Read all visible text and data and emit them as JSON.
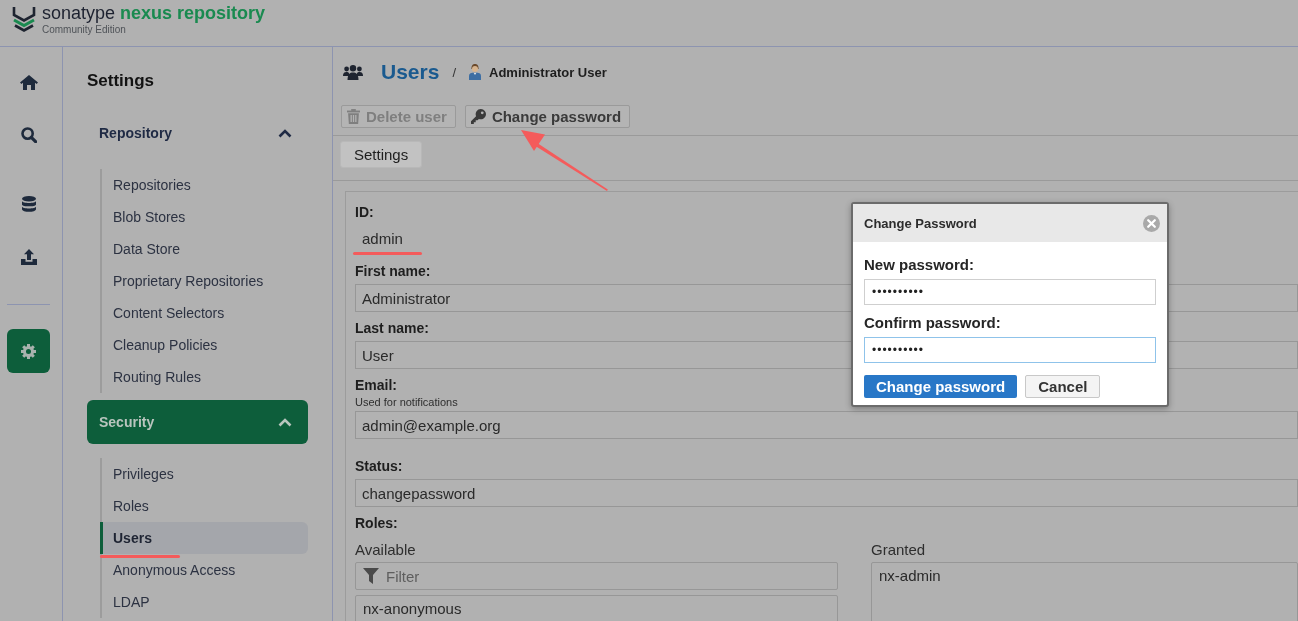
{
  "header": {
    "brand": "sonatype",
    "product": "nexus repository",
    "edition": "Community Edition"
  },
  "rail": {
    "groups": [
      {
        "divider": false,
        "items": [
          {
            "selected": false
          },
          {
            "selected": false
          }
        ]
      },
      {
        "divider": false,
        "items": [
          {
            "selected": false
          },
          {
            "selected": false
          }
        ]
      },
      {
        "divider": true,
        "items": [
          {
            "selected": true
          }
        ]
      }
    ]
  },
  "sidebar": {
    "title": "Settings",
    "groups": [
      {
        "label": "Repository",
        "selected": false,
        "expanded": true,
        "items": [
          {
            "label": "Repositories",
            "selected": false,
            "annotated": false
          },
          {
            "label": "Blob Stores",
            "selected": false,
            "annotated": false
          },
          {
            "label": "Data Store",
            "selected": false,
            "annotated": false
          },
          {
            "label": "Proprietary Repositories",
            "selected": false,
            "annotated": false
          },
          {
            "label": "Content Selectors",
            "selected": false,
            "annotated": false
          },
          {
            "label": "Cleanup Policies",
            "selected": false,
            "annotated": false
          },
          {
            "label": "Routing Rules",
            "selected": false,
            "annotated": false
          }
        ]
      },
      {
        "label": "Security",
        "selected": true,
        "expanded": true,
        "items": [
          {
            "label": "Privileges",
            "selected": false,
            "annotated": false
          },
          {
            "label": "Roles",
            "selected": false,
            "annotated": false
          },
          {
            "label": "Users",
            "selected": true,
            "annotated": true
          },
          {
            "label": "Anonymous Access",
            "selected": false,
            "annotated": false
          },
          {
            "label": "LDAP",
            "selected": false,
            "annotated": false
          }
        ]
      }
    ]
  },
  "page": {
    "title": "Users",
    "separator": "/",
    "breadcrumb": "Administrator User"
  },
  "toolbar": [
    {
      "label": "Delete user",
      "disabled": true,
      "annotated": false
    },
    {
      "label": "Change password",
      "disabled": false,
      "annotated": true
    }
  ],
  "tabs": [
    {
      "label": "Settings",
      "selected": true
    }
  ],
  "form": {
    "fields": [
      {
        "kind": "text",
        "label": "ID:",
        "value": "admin",
        "annotated": true
      },
      {
        "kind": "input",
        "label": "First name:",
        "value": "Administrator",
        "annotated": false
      },
      {
        "kind": "input",
        "label": "Last name:",
        "value": "User",
        "annotated": false
      },
      {
        "kind": "input",
        "label": "Email:",
        "help": "Used for notifications",
        "value": "admin@example.org",
        "annotated": false
      },
      {
        "kind": "input",
        "label": "Status:",
        "value": "changepassword",
        "annotated": false
      }
    ],
    "roles": {
      "label": "Roles:",
      "available": {
        "label": "Available",
        "filter_placeholder": "Filter",
        "items": [
          {
            "label": "nx-anonymous",
            "selected": false
          }
        ]
      },
      "granted": {
        "label": "Granted",
        "items": [
          {
            "label": "nx-admin",
            "selected": false
          }
        ]
      }
    }
  },
  "dialog": {
    "title": "Change Password",
    "fields": [
      {
        "label": "New password:",
        "value": "••••••••••",
        "focused": false
      },
      {
        "label": "Confirm password:",
        "value": "••••••••••",
        "focused": true
      }
    ],
    "buttons": [
      {
        "label": "Change password",
        "kind": "primary"
      },
      {
        "label": "Cancel",
        "kind": "secondary"
      }
    ]
  }
}
